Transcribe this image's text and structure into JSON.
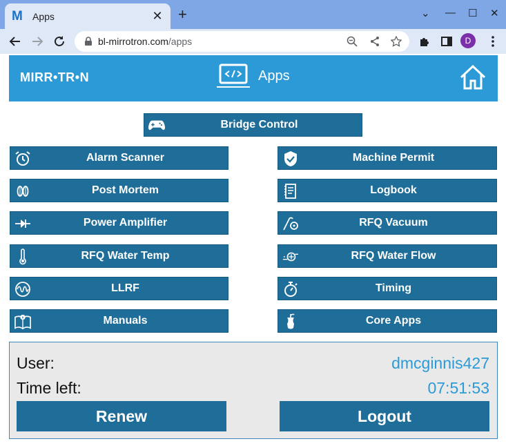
{
  "browser": {
    "tab_logo": "M",
    "tab_title": "Apps",
    "url_domain": "bl-mirrotron.com",
    "url_path": "/apps",
    "avatar_letter": "D"
  },
  "header": {
    "brand": "MIRR•TR•N",
    "title": "Apps"
  },
  "buttons": {
    "bridge_control": "Bridge Control",
    "alarm_scanner": "Alarm Scanner",
    "machine_permit": "Machine Permit",
    "post_mortem": "Post Mortem",
    "logbook": "Logbook",
    "power_amplifier": "Power Amplifier",
    "rfq_vacuum": "RFQ Vacuum",
    "rfq_water_temp": "RFQ Water Temp",
    "rfq_water_flow": "RFQ Water Flow",
    "llrf": "LLRF",
    "timing": "Timing",
    "manuals": "Manuals",
    "core_apps": "Core Apps"
  },
  "session": {
    "user_label": "User:",
    "user_value": "dmcginnis427",
    "time_label": "Time left:",
    "time_value": "07:51:53",
    "renew": "Renew",
    "logout": "Logout"
  },
  "colors": {
    "header_bg": "#2b9ad7",
    "button_bg": "#1e6e99",
    "accent_text": "#2b9ad7"
  }
}
